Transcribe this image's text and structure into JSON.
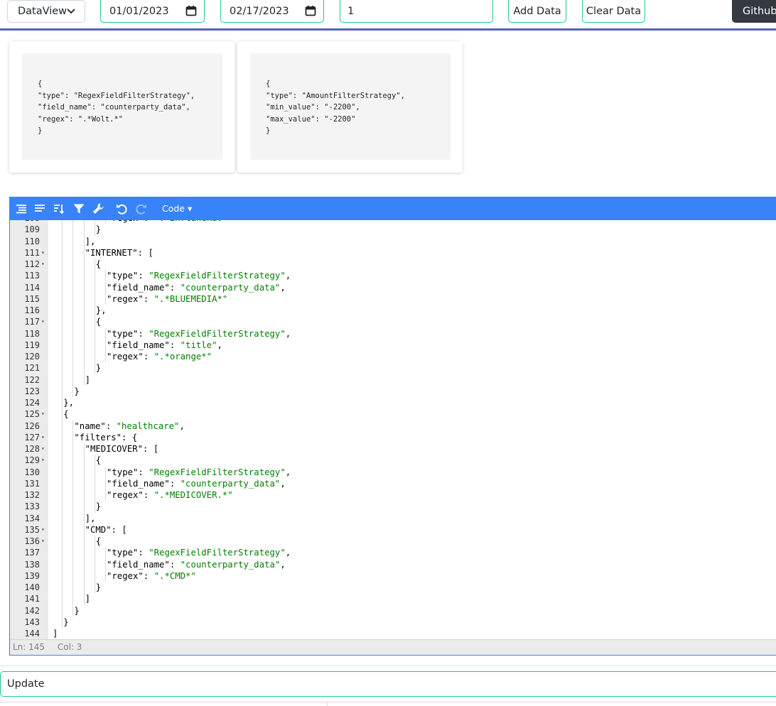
{
  "toolbar": {
    "view_select": "DataView",
    "start_date": "01/01/2023",
    "end_date": "02/17/2023",
    "number_value": "1",
    "add_label": "Add Data",
    "clear_label": "Clear Data",
    "github_label": "Github"
  },
  "cards": [
    {
      "text": "{\n\"type\": \"RegexFieldFilterStrategy\",\n\"field_name\": \"counterparty_data\",\n\"regex\": \".*Wolt.*\"\n}"
    },
    {
      "text": "{\n\"type\": \"AmountFilterStrategy\",\n\"min_value\": \"-2200\",\n\"max_value\": \"-2200\"\n}"
    }
  ],
  "editor": {
    "mode_label": "Code ▾",
    "status": {
      "line": "Ln: 145",
      "col": "Col: 3"
    },
    "menu_icons": [
      "format-icon",
      "compact-icon",
      "sort-icon",
      "filter-icon",
      "repair-icon",
      "undo-icon",
      "redo-icon"
    ],
    "lines": [
      {
        "n": "108",
        "ind": 6,
        "k": "regex",
        "v": "\".*Inflancka.*\"",
        "t": ""
      },
      {
        "n": "109",
        "ind": 5,
        "t": "}"
      },
      {
        "n": "110",
        "ind": 4,
        "t": "],"
      },
      {
        "n": "111",
        "ind": 4,
        "f": true,
        "k": "INTERNET",
        "t": ": ["
      },
      {
        "n": "112",
        "ind": 5,
        "f": true,
        "t": "{"
      },
      {
        "n": "113",
        "ind": 6,
        "k": "type",
        "v": "\"RegexFieldFilterStrategy\"",
        "t": ","
      },
      {
        "n": "114",
        "ind": 6,
        "k": "field_name",
        "v": "\"counterparty_data\"",
        "t": ","
      },
      {
        "n": "115",
        "ind": 6,
        "k": "regex",
        "v": "\".*BLUEMEDIA*\"",
        "t": ""
      },
      {
        "n": "116",
        "ind": 5,
        "t": "},"
      },
      {
        "n": "117",
        "ind": 5,
        "f": true,
        "t": "{"
      },
      {
        "n": "118",
        "ind": 6,
        "k": "type",
        "v": "\"RegexFieldFilterStrategy\"",
        "t": ","
      },
      {
        "n": "119",
        "ind": 6,
        "k": "field_name",
        "v": "\"title\"",
        "t": ","
      },
      {
        "n": "120",
        "ind": 6,
        "k": "regex",
        "v": "\".*orange*\"",
        "t": ""
      },
      {
        "n": "121",
        "ind": 5,
        "t": "}"
      },
      {
        "n": "122",
        "ind": 4,
        "t": "]"
      },
      {
        "n": "123",
        "ind": 3,
        "t": "}"
      },
      {
        "n": "124",
        "ind": 2,
        "t": "},"
      },
      {
        "n": "125",
        "ind": 2,
        "f": true,
        "t": "{"
      },
      {
        "n": "126",
        "ind": 3,
        "k": "name",
        "v": "\"healthcare\"",
        "t": ","
      },
      {
        "n": "127",
        "ind": 3,
        "f": true,
        "k": "filters",
        "t": ": {"
      },
      {
        "n": "128",
        "ind": 4,
        "f": true,
        "k": "MEDICOVER",
        "t": ": ["
      },
      {
        "n": "129",
        "ind": 5,
        "f": true,
        "t": "{"
      },
      {
        "n": "130",
        "ind": 6,
        "k": "type",
        "v": "\"RegexFieldFilterStrategy\"",
        "t": ","
      },
      {
        "n": "131",
        "ind": 6,
        "k": "field_name",
        "v": "\"counterparty_data\"",
        "t": ","
      },
      {
        "n": "132",
        "ind": 6,
        "k": "regex",
        "v": "\".*MEDICOVER.*\"",
        "t": ""
      },
      {
        "n": "133",
        "ind": 5,
        "t": "}"
      },
      {
        "n": "134",
        "ind": 4,
        "t": "],"
      },
      {
        "n": "135",
        "ind": 4,
        "f": true,
        "k": "CMD",
        "t": ": ["
      },
      {
        "n": "136",
        "ind": 5,
        "f": true,
        "t": "{"
      },
      {
        "n": "137",
        "ind": 6,
        "k": "type",
        "v": "\"RegexFieldFilterStrategy\"",
        "t": ","
      },
      {
        "n": "138",
        "ind": 6,
        "k": "field_name",
        "v": "\"counterparty_data\"",
        "t": ","
      },
      {
        "n": "139",
        "ind": 6,
        "k": "regex",
        "v": "\".*CMD*\"",
        "t": ""
      },
      {
        "n": "140",
        "ind": 5,
        "t": "}"
      },
      {
        "n": "141",
        "ind": 4,
        "t": "]"
      },
      {
        "n": "142",
        "ind": 3,
        "t": "}"
      },
      {
        "n": "143",
        "ind": 2,
        "t": "}"
      },
      {
        "n": "144",
        "ind": 1,
        "t": "]"
      }
    ]
  },
  "update_label": "Update"
}
